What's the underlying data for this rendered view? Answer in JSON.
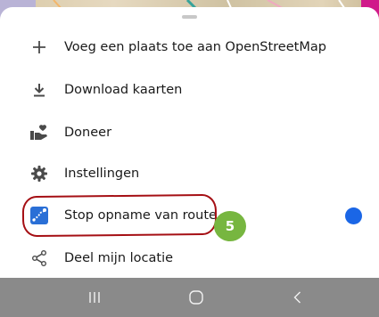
{
  "menu": {
    "items": [
      {
        "label": "Voeg een plaats toe aan OpenStreetMap",
        "icon": "plus-icon"
      },
      {
        "label": "Download kaarten",
        "icon": "download-icon"
      },
      {
        "label": "Doneer",
        "icon": "donate-hand-heart-icon"
      },
      {
        "label": "Instellingen",
        "icon": "gear-icon"
      },
      {
        "label": "Stop opname van route",
        "icon": "route-recording-icon",
        "toggle_on": true,
        "toggle_color": "#1a66e6"
      },
      {
        "label": "Deel mijn locatie",
        "icon": "share-icon"
      }
    ]
  },
  "annotation": {
    "step_number": "5",
    "badge_color": "#77b640",
    "ring_color": "#a50f14"
  },
  "navbar": {
    "buttons": [
      "recent-apps-icon",
      "home-icon",
      "back-icon"
    ],
    "background": "#8a8a8a"
  }
}
